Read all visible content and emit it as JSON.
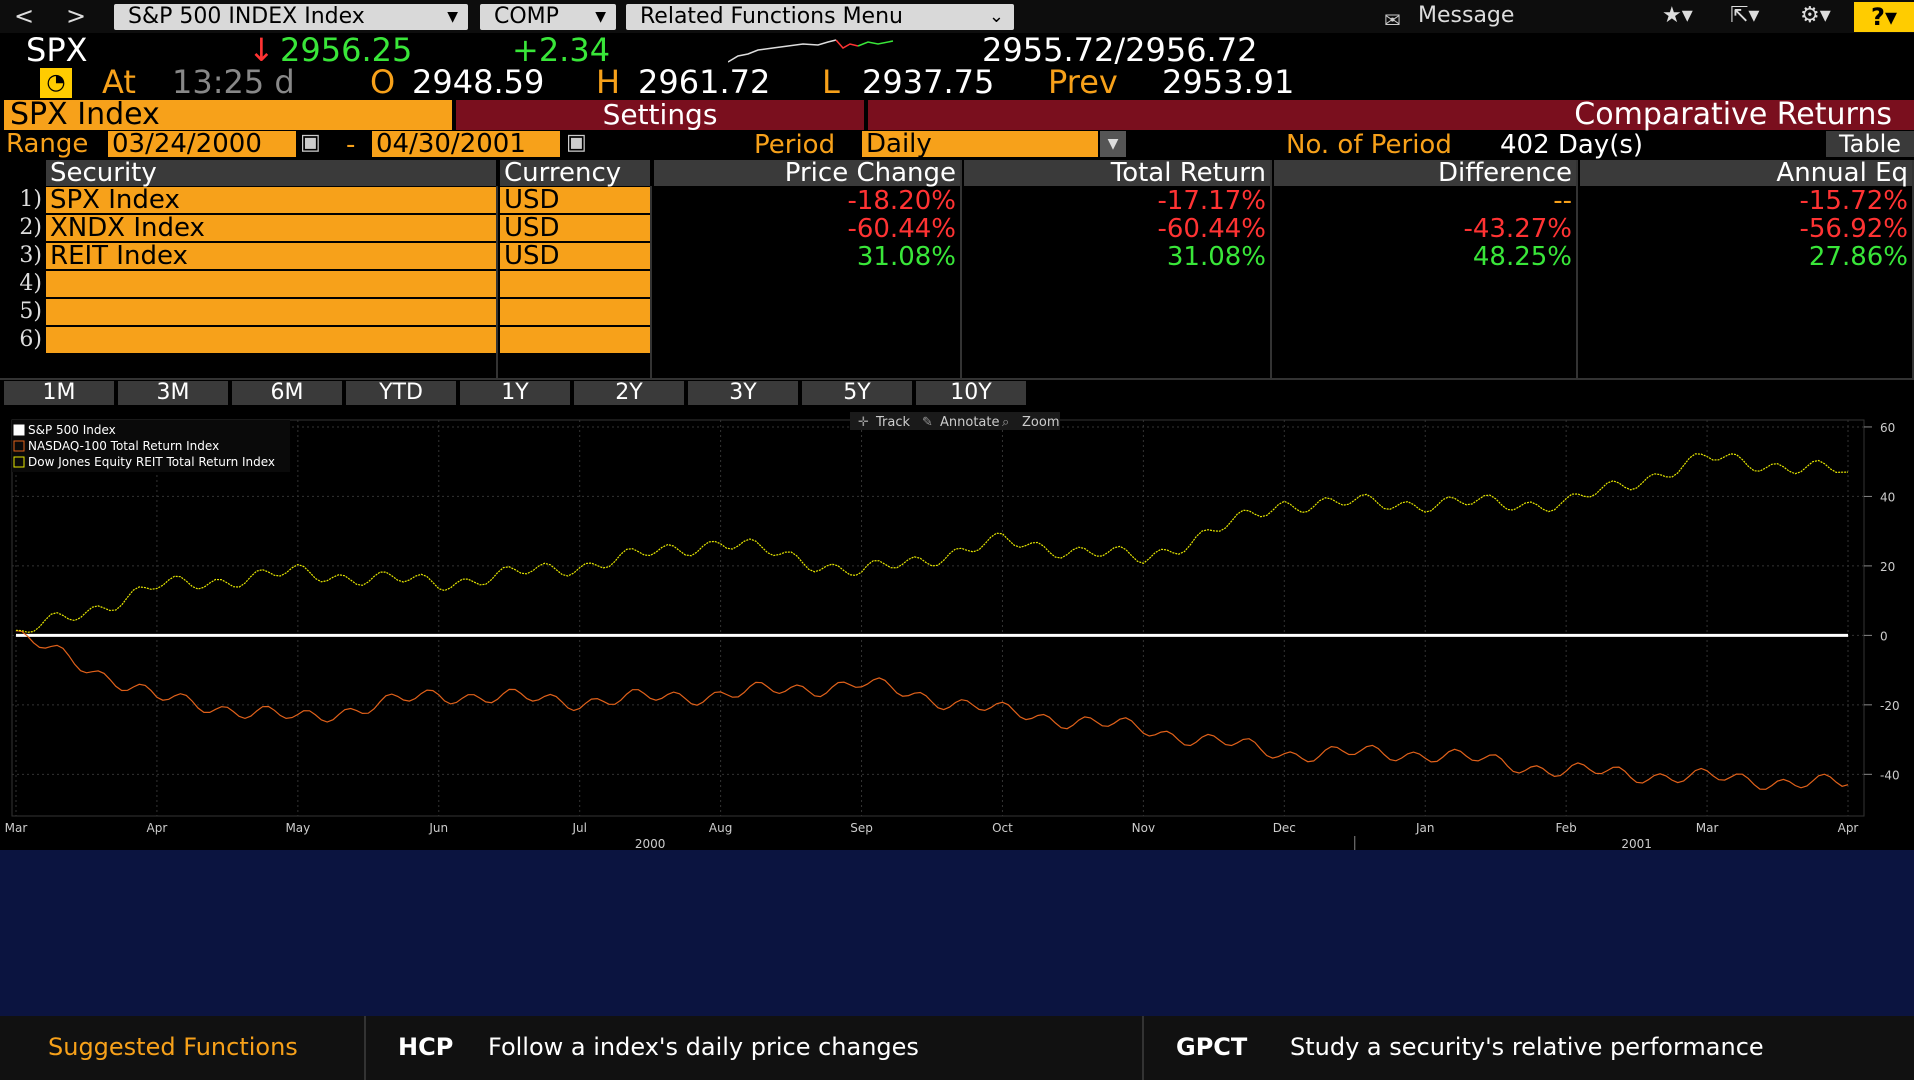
{
  "toolbar": {
    "back": "<",
    "forward": ">",
    "security_menu": "S&P 500 INDEX Index",
    "function_menu": "COMP",
    "related_menu": "Related Functions Menu",
    "message": "Message",
    "help": "?"
  },
  "quote": {
    "ticker": "SPX",
    "last": "2956.25",
    "change": "+2.34",
    "bid_ask": "2955.72/2956.72",
    "at_label": "At",
    "time": "13:25 d",
    "open_label": "O",
    "open": "2948.59",
    "high_label": "H",
    "high": "2961.72",
    "low_label": "L",
    "low": "2937.75",
    "prev_label": "Prev",
    "prev": "2953.91"
  },
  "header": {
    "security": "SPX Index",
    "settings": "Settings",
    "title": "Comparative Returns"
  },
  "controls": {
    "range_label": "Range",
    "start_date": "03/24/2000",
    "dash": "-",
    "end_date": "04/30/2001",
    "period_label": "Period",
    "period_value": "Daily",
    "nop_label": "No. of Period",
    "nop_value": "402 Day(s)",
    "table_btn": "Table"
  },
  "table": {
    "columns": [
      "Security",
      "Currency",
      "Price Change",
      "Total Return",
      "Difference",
      "Annual Eq"
    ],
    "rows": [
      {
        "num": "1)",
        "security": "SPX Index",
        "currency": "USD",
        "price_change": "-18.20%",
        "total_return": "-17.17%",
        "difference": "--",
        "annual_eq": "-15.72%"
      },
      {
        "num": "2)",
        "security": "XNDX Index",
        "currency": "USD",
        "price_change": "-60.44%",
        "total_return": "-60.44%",
        "difference": "-43.27%",
        "annual_eq": "-56.92%"
      },
      {
        "num": "3)",
        "security": "REIT Index",
        "currency": "USD",
        "price_change": "31.08%",
        "total_return": "31.08%",
        "difference": "48.25%",
        "annual_eq": "27.86%"
      },
      {
        "num": "4)",
        "security": "",
        "currency": "",
        "price_change": "",
        "total_return": "",
        "difference": "",
        "annual_eq": ""
      },
      {
        "num": "5)",
        "security": "",
        "currency": "",
        "price_change": "",
        "total_return": "",
        "difference": "",
        "annual_eq": ""
      },
      {
        "num": "6)",
        "security": "",
        "currency": "",
        "price_change": "",
        "total_return": "",
        "difference": "",
        "annual_eq": ""
      }
    ]
  },
  "periods": [
    "1M",
    "3M",
    "6M",
    "YTD",
    "1Y",
    "2Y",
    "3Y",
    "5Y",
    "10Y"
  ],
  "chart_tools": {
    "track": "Track",
    "annotate": "Annotate",
    "zoom": "Zoom"
  },
  "colors": {
    "orange": "#f7a11a",
    "maroon": "#7a0f1e",
    "green": "#39e639",
    "red": "#ff3333",
    "spx": "#ffffff",
    "ndx": "#e0611a",
    "reit": "#e6e600"
  },
  "chart_data": {
    "type": "line",
    "series": [
      {
        "name": "S&P 500 Index",
        "x": [
          "Mar",
          "Apr",
          "May",
          "Jun",
          "Jul",
          "Aug",
          "Sep",
          "Oct",
          "Nov",
          "Dec",
          "Jan",
          "Feb",
          "Mar",
          "Apr"
        ],
        "values": [
          0,
          0,
          0,
          0,
          0,
          0,
          0,
          0,
          0,
          0,
          0,
          0,
          0,
          0
        ]
      },
      {
        "name": "NASDAQ-100 Total Return Index",
        "x": [
          "Mar",
          "Apr",
          "May",
          "Jun",
          "Jul",
          "Aug",
          "Sep",
          "Oct",
          "Nov",
          "Dec",
          "Jan",
          "Feb",
          "Mar",
          "Apr"
        ],
        "values": [
          0,
          -18,
          -24,
          -17,
          -19,
          -17,
          -14,
          -22,
          -27,
          -34,
          -34,
          -39,
          -41,
          -43
        ]
      },
      {
        "name": "Dow Jones Equity REIT Total Return Index",
        "x": [
          "Mar",
          "Apr",
          "May",
          "Jun",
          "Jul",
          "Aug",
          "Sep",
          "Oct",
          "Nov",
          "Dec",
          "Jan",
          "Feb",
          "Mar",
          "Apr"
        ],
        "values": [
          0,
          14,
          18,
          15,
          20,
          27,
          18,
          27,
          22,
          38,
          38,
          38,
          51,
          47
        ]
      }
    ],
    "x_ticks": [
      "Mar",
      "Apr",
      "May",
      "Jun",
      "Jul",
      "Aug",
      "Sep",
      "Oct",
      "Nov",
      "Dec",
      "Jan",
      "Feb",
      "Mar",
      "Apr"
    ],
    "year_labels": [
      "2000",
      "2001"
    ],
    "y_ticks": [
      "60",
      "40",
      "20",
      "0",
      "-20",
      "-40"
    ],
    "ylim": [
      -52,
      62
    ],
    "grid": true,
    "legend_position": "top-left"
  },
  "footer": {
    "suggested": "Suggested Functions",
    "f1_code": "HCP",
    "f1_desc": "Follow a index's daily price changes",
    "f2_code": "GPCT",
    "f2_desc": "Study a security's relative performance"
  }
}
